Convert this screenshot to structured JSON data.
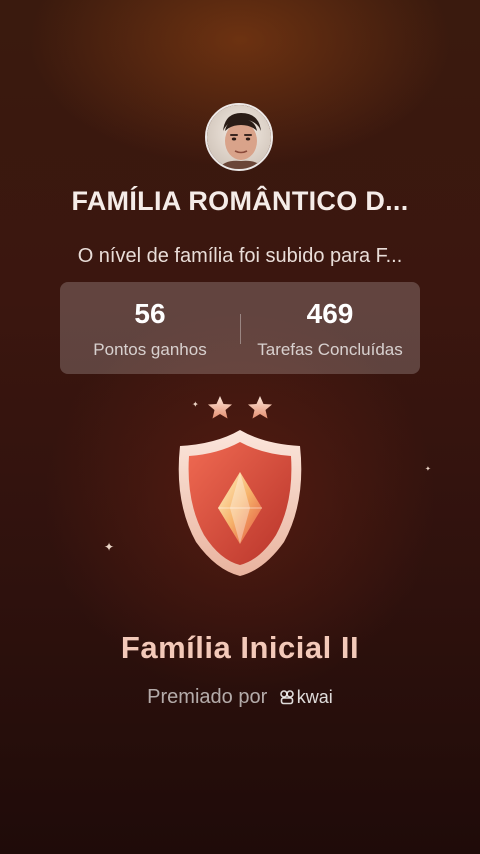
{
  "profile": {
    "family_name": "FAMÍLIA ROMÂNTICO D...",
    "level_message": "O nível de família foi subido para F..."
  },
  "stats": [
    {
      "value": "56",
      "label": "Pontos ganhos"
    },
    {
      "value": "469",
      "label": "Tarefas Concluídas"
    }
  ],
  "badge": {
    "stars": 2,
    "level_name": "Família Inicial II"
  },
  "awarded": {
    "prefix": "Premiado por",
    "brand": "kwai"
  },
  "colors": {
    "background_top": "#3a1a0e",
    "background_bottom": "#1f0b09",
    "level_title": "#f3c9b9",
    "badge_accent": "#d9483a"
  }
}
